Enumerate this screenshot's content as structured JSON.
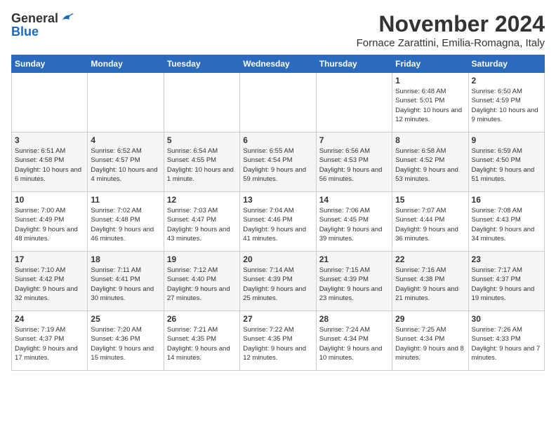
{
  "logo": {
    "general": "General",
    "blue": "Blue"
  },
  "header": {
    "month": "November 2024",
    "location": "Fornace Zarattini, Emilia-Romagna, Italy"
  },
  "weekdays": [
    "Sunday",
    "Monday",
    "Tuesday",
    "Wednesday",
    "Thursday",
    "Friday",
    "Saturday"
  ],
  "weeks": [
    [
      {
        "day": "",
        "info": ""
      },
      {
        "day": "",
        "info": ""
      },
      {
        "day": "",
        "info": ""
      },
      {
        "day": "",
        "info": ""
      },
      {
        "day": "",
        "info": ""
      },
      {
        "day": "1",
        "info": "Sunrise: 6:48 AM\nSunset: 5:01 PM\nDaylight: 10 hours and 12 minutes."
      },
      {
        "day": "2",
        "info": "Sunrise: 6:50 AM\nSunset: 4:59 PM\nDaylight: 10 hours and 9 minutes."
      }
    ],
    [
      {
        "day": "3",
        "info": "Sunrise: 6:51 AM\nSunset: 4:58 PM\nDaylight: 10 hours and 6 minutes."
      },
      {
        "day": "4",
        "info": "Sunrise: 6:52 AM\nSunset: 4:57 PM\nDaylight: 10 hours and 4 minutes."
      },
      {
        "day": "5",
        "info": "Sunrise: 6:54 AM\nSunset: 4:55 PM\nDaylight: 10 hours and 1 minute."
      },
      {
        "day": "6",
        "info": "Sunrise: 6:55 AM\nSunset: 4:54 PM\nDaylight: 9 hours and 59 minutes."
      },
      {
        "day": "7",
        "info": "Sunrise: 6:56 AM\nSunset: 4:53 PM\nDaylight: 9 hours and 56 minutes."
      },
      {
        "day": "8",
        "info": "Sunrise: 6:58 AM\nSunset: 4:52 PM\nDaylight: 9 hours and 53 minutes."
      },
      {
        "day": "9",
        "info": "Sunrise: 6:59 AM\nSunset: 4:50 PM\nDaylight: 9 hours and 51 minutes."
      }
    ],
    [
      {
        "day": "10",
        "info": "Sunrise: 7:00 AM\nSunset: 4:49 PM\nDaylight: 9 hours and 48 minutes."
      },
      {
        "day": "11",
        "info": "Sunrise: 7:02 AM\nSunset: 4:48 PM\nDaylight: 9 hours and 46 minutes."
      },
      {
        "day": "12",
        "info": "Sunrise: 7:03 AM\nSunset: 4:47 PM\nDaylight: 9 hours and 43 minutes."
      },
      {
        "day": "13",
        "info": "Sunrise: 7:04 AM\nSunset: 4:46 PM\nDaylight: 9 hours and 41 minutes."
      },
      {
        "day": "14",
        "info": "Sunrise: 7:06 AM\nSunset: 4:45 PM\nDaylight: 9 hours and 39 minutes."
      },
      {
        "day": "15",
        "info": "Sunrise: 7:07 AM\nSunset: 4:44 PM\nDaylight: 9 hours and 36 minutes."
      },
      {
        "day": "16",
        "info": "Sunrise: 7:08 AM\nSunset: 4:43 PM\nDaylight: 9 hours and 34 minutes."
      }
    ],
    [
      {
        "day": "17",
        "info": "Sunrise: 7:10 AM\nSunset: 4:42 PM\nDaylight: 9 hours and 32 minutes."
      },
      {
        "day": "18",
        "info": "Sunrise: 7:11 AM\nSunset: 4:41 PM\nDaylight: 9 hours and 30 minutes."
      },
      {
        "day": "19",
        "info": "Sunrise: 7:12 AM\nSunset: 4:40 PM\nDaylight: 9 hours and 27 minutes."
      },
      {
        "day": "20",
        "info": "Sunrise: 7:14 AM\nSunset: 4:39 PM\nDaylight: 9 hours and 25 minutes."
      },
      {
        "day": "21",
        "info": "Sunrise: 7:15 AM\nSunset: 4:39 PM\nDaylight: 9 hours and 23 minutes."
      },
      {
        "day": "22",
        "info": "Sunrise: 7:16 AM\nSunset: 4:38 PM\nDaylight: 9 hours and 21 minutes."
      },
      {
        "day": "23",
        "info": "Sunrise: 7:17 AM\nSunset: 4:37 PM\nDaylight: 9 hours and 19 minutes."
      }
    ],
    [
      {
        "day": "24",
        "info": "Sunrise: 7:19 AM\nSunset: 4:37 PM\nDaylight: 9 hours and 17 minutes."
      },
      {
        "day": "25",
        "info": "Sunrise: 7:20 AM\nSunset: 4:36 PM\nDaylight: 9 hours and 15 minutes."
      },
      {
        "day": "26",
        "info": "Sunrise: 7:21 AM\nSunset: 4:35 PM\nDaylight: 9 hours and 14 minutes."
      },
      {
        "day": "27",
        "info": "Sunrise: 7:22 AM\nSunset: 4:35 PM\nDaylight: 9 hours and 12 minutes."
      },
      {
        "day": "28",
        "info": "Sunrise: 7:24 AM\nSunset: 4:34 PM\nDaylight: 9 hours and 10 minutes."
      },
      {
        "day": "29",
        "info": "Sunrise: 7:25 AM\nSunset: 4:34 PM\nDaylight: 9 hours and 8 minutes."
      },
      {
        "day": "30",
        "info": "Sunrise: 7:26 AM\nSunset: 4:33 PM\nDaylight: 9 hours and 7 minutes."
      }
    ]
  ]
}
